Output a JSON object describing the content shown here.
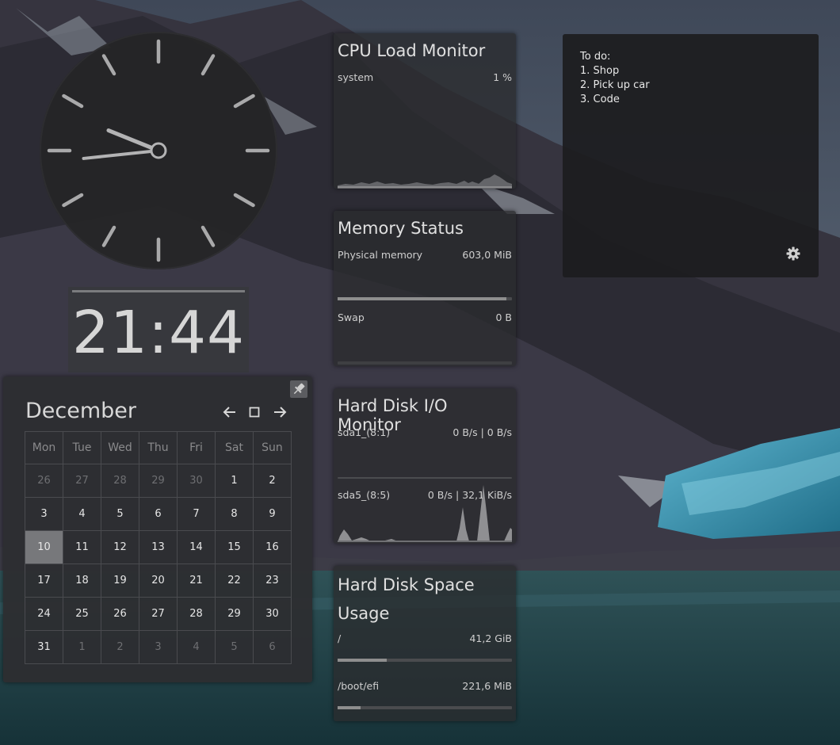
{
  "clock": {
    "hour": 21,
    "minute": 44,
    "digital": "21:44"
  },
  "calendar": {
    "month": "December",
    "weekdays": [
      "Mon",
      "Tue",
      "Wed",
      "Thu",
      "Fri",
      "Sat",
      "Sun"
    ],
    "weeks": [
      [
        {
          "d": "26",
          "dim": true
        },
        {
          "d": "27",
          "dim": true
        },
        {
          "d": "28",
          "dim": true
        },
        {
          "d": "29",
          "dim": true
        },
        {
          "d": "30",
          "dim": true
        },
        {
          "d": "1"
        },
        {
          "d": "2"
        }
      ],
      [
        {
          "d": "3"
        },
        {
          "d": "4"
        },
        {
          "d": "5"
        },
        {
          "d": "6"
        },
        {
          "d": "7"
        },
        {
          "d": "8"
        },
        {
          "d": "9"
        }
      ],
      [
        {
          "d": "10",
          "today": true
        },
        {
          "d": "11"
        },
        {
          "d": "12"
        },
        {
          "d": "13"
        },
        {
          "d": "14"
        },
        {
          "d": "15"
        },
        {
          "d": "16"
        }
      ],
      [
        {
          "d": "17"
        },
        {
          "d": "18"
        },
        {
          "d": "19"
        },
        {
          "d": "20"
        },
        {
          "d": "21"
        },
        {
          "d": "22"
        },
        {
          "d": "23"
        }
      ],
      [
        {
          "d": "24"
        },
        {
          "d": "25"
        },
        {
          "d": "26"
        },
        {
          "d": "27"
        },
        {
          "d": "28"
        },
        {
          "d": "29"
        },
        {
          "d": "30"
        }
      ],
      [
        {
          "d": "31"
        },
        {
          "d": "1",
          "dim": true
        },
        {
          "d": "2",
          "dim": true
        },
        {
          "d": "3",
          "dim": true
        },
        {
          "d": "4",
          "dim": true
        },
        {
          "d": "5",
          "dim": true
        },
        {
          "d": "6",
          "dim": true
        }
      ]
    ]
  },
  "cpu": {
    "title": "CPU Load Monitor",
    "label": "system",
    "value": "1 %"
  },
  "memory": {
    "title": "Memory Status",
    "physical_label": "Physical memory",
    "physical_value": "603,0 MiB",
    "physical_fraction": 0.97,
    "swap_label": "Swap",
    "swap_value": "0 B",
    "swap_fraction": 0
  },
  "disk_io": {
    "title": "Hard Disk I/O Monitor",
    "dev1_label": "sda1_(8:1)",
    "dev1_value": "0 B/s | 0 B/s",
    "dev2_label": "sda5_(8:5)",
    "dev2_value": "0 B/s | 32,1 KiB/s"
  },
  "disk_space": {
    "title": "Hard Disk Space Usage",
    "root_label": "/",
    "root_value": "41,2 GiB",
    "root_fraction": 0.28,
    "efi_label": "/boot/efi",
    "efi_value": "221,6 MiB",
    "efi_fraction": 0.13
  },
  "notes": {
    "lines": [
      "To do:",
      "1. Shop",
      "2. Pick up car",
      "3. Code"
    ]
  }
}
